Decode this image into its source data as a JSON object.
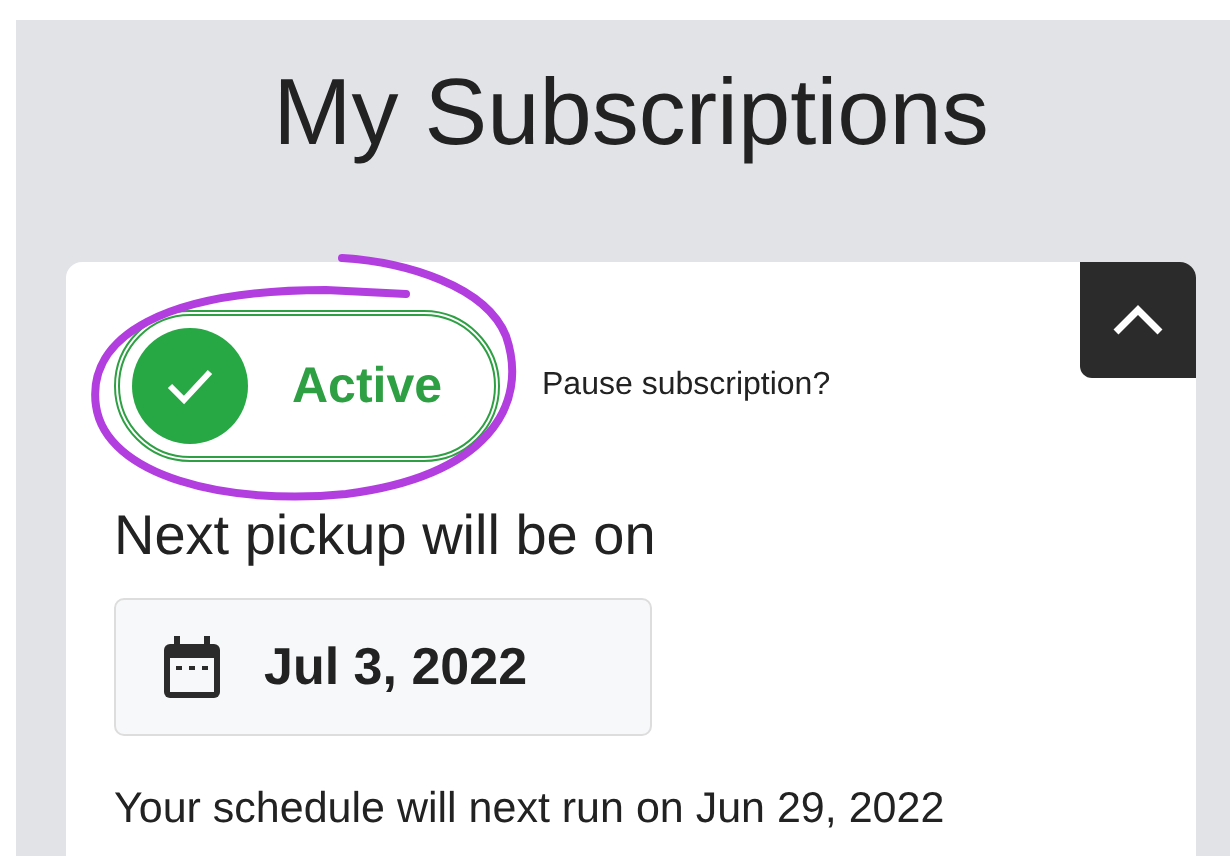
{
  "page": {
    "title": "My Subscriptions"
  },
  "subscription": {
    "expanded": true,
    "status": {
      "label": "Active",
      "active": true
    },
    "pause_link": "Pause subscription?",
    "pickup_heading": "Next pickup will be on",
    "pickup_date": "Jul 3, 2022",
    "schedule_note": "Your schedule will next run on Jun 29, 2022"
  }
}
